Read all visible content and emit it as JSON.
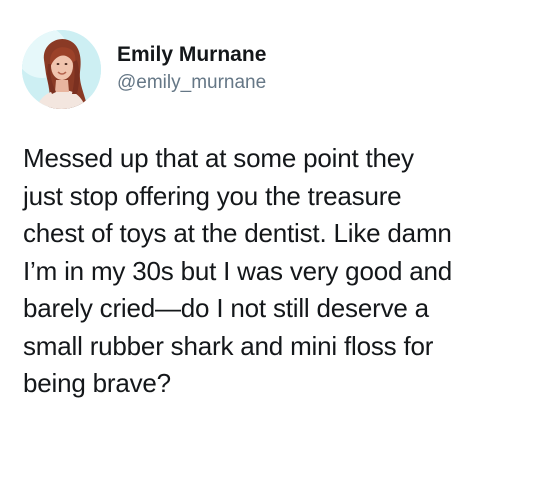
{
  "tweet": {
    "author": {
      "display_name": "Emily Murnane",
      "handle": "@emily_murnane"
    },
    "text_lines": [
      "Messed up that at some point they",
      "just stop offering you the treasure",
      "chest of toys at the dentist. Like damn",
      "I’m in my 30s but I was very good and",
      "barely cried—do I not still deserve a",
      "small rubber shark and mini floss for",
      "being brave?"
    ]
  },
  "colors": {
    "name": "#14171a",
    "handle": "#657786",
    "avatar_background": "#cdeff3"
  },
  "icons": {
    "avatar": "profile-photo"
  }
}
